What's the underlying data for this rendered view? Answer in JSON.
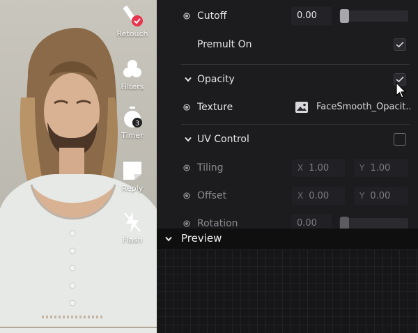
{
  "camera_controls": [
    {
      "label": "Retouch",
      "icon": "retouch-wand-icon"
    },
    {
      "label": "Filters",
      "icon": "filters-icon"
    },
    {
      "label": "Timer",
      "icon": "timer-icon"
    },
    {
      "label": "Reply",
      "icon": "reply-icon"
    },
    {
      "label": "Flash",
      "icon": "flash-off-icon"
    }
  ],
  "timer_badge": "3",
  "properties": {
    "cutoff": {
      "label": "Cutoff",
      "value": "0.00"
    },
    "premult": {
      "label": "Premult On",
      "checked": true
    },
    "opacity": {
      "label": "Opacity",
      "checked": true
    },
    "texture": {
      "label": "Texture",
      "value": "FaceSmooth_Opacit..."
    },
    "uv_control": {
      "label": "UV Control",
      "checked": false
    },
    "tiling": {
      "label": "Tiling",
      "x_axis": "X",
      "x": "1.00",
      "y_axis": "Y",
      "y": "1.00"
    },
    "offset": {
      "label": "Offset",
      "x_axis": "X",
      "x": "0.00",
      "y_axis": "Y",
      "y": "0.00"
    },
    "rotation": {
      "label": "Rotation",
      "value": "0.00"
    }
  },
  "preview": {
    "label": "Preview"
  },
  "colors": {
    "accent_badge": "#e8344e",
    "panel_bg": "#1c1c1f",
    "preview_bg": "#0f0f10"
  }
}
